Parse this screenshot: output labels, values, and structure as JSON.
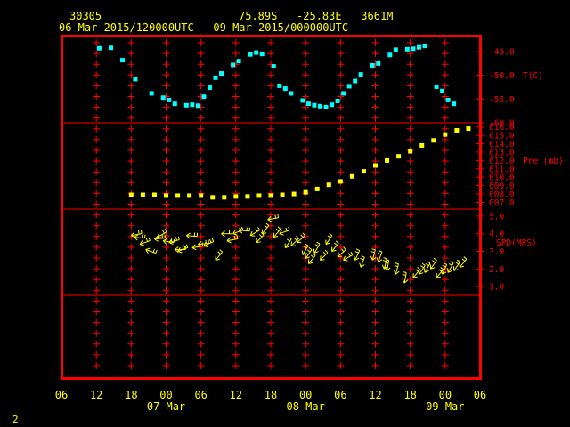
{
  "header": {
    "station": "30305",
    "location": "75.89S   -25.83E   3661M",
    "time_range": "06 Mar 2015/120000UTC - 09 Mar 2015/000000UTC"
  },
  "page_number": "2",
  "colors": {
    "frame": "#ff0000",
    "axis_text": "#ffff00",
    "panel_text": "#ff0000",
    "temperature": "#00ffff",
    "pressure": "#ffff00",
    "wind": "#ffff00"
  },
  "chart_data": {
    "type": "scatter",
    "x_axis": {
      "range_hours": [
        0,
        72
      ],
      "tick_labels": [
        "06",
        "12",
        "18",
        "00",
        "06",
        "12",
        "18",
        "00",
        "06",
        "12",
        "18",
        "00",
        "06"
      ],
      "day_labels": [
        {
          "hour": 18,
          "label": "07 Mar"
        },
        {
          "hour": 42,
          "label": "08 Mar"
        },
        {
          "hour": 66,
          "label": "09 Mar"
        }
      ]
    },
    "panels": [
      {
        "name": "temperature",
        "label": "T(C)",
        "range": [
          -60.0,
          -42.0
        ],
        "tick_labels": [
          "-45.0",
          "-50.0",
          "-55.0",
          "-60.0"
        ],
        "tick_values": [
          -45,
          -50,
          -55,
          -60
        ],
        "x": [
          6.5,
          8.5,
          10.5,
          12.7,
          15.5,
          17.5,
          18.5,
          19.5,
          21.5,
          22.5,
          23.5,
          24.5,
          25.5,
          26.5,
          27.5,
          29.5,
          30.5,
          32.5,
          33.5,
          34.5,
          36.5,
          37.5,
          38.5,
          39.5,
          41.5,
          42.5,
          43.5,
          44.5,
          45.5,
          46.5,
          47.5,
          48.5,
          49.5,
          50.5,
          51.5,
          53.5,
          54.5,
          56.5,
          57.5,
          59.5,
          60.5,
          61.5,
          62.5,
          64.5,
          65.5,
          66.5,
          67.5
        ],
        "y": [
          -44.3,
          -44.2,
          -46.8,
          -50.8,
          -53.8,
          -54.7,
          -55.2,
          -56.0,
          -56.3,
          -56.2,
          -56.4,
          -54.5,
          -52.6,
          -50.5,
          -49.6,
          -47.8,
          -47.0,
          -45.6,
          -45.2,
          -45.5,
          -48.1,
          -52.2,
          -52.8,
          -53.8,
          -55.3,
          -56.0,
          -56.3,
          -56.5,
          -56.7,
          -56.2,
          -55.4,
          -53.8,
          -52.3,
          -51.2,
          -49.8,
          -47.9,
          -47.5,
          -45.7,
          -44.6,
          -44.5,
          -44.4,
          -44.1,
          -43.8,
          -52.4,
          -53.3,
          -55.2,
          -56.0
        ]
      },
      {
        "name": "pressure",
        "label": "Pre (mb)",
        "range": [
          606.2,
          616.5
        ],
        "tick_labels": [
          "616.0",
          "615.0",
          "614.0",
          "613.0",
          "612.0",
          "611.0",
          "610.0",
          "609.0",
          "608.0",
          "607.0"
        ],
        "tick_values": [
          616,
          615,
          614,
          613,
          612,
          611,
          610,
          609,
          608,
          607
        ],
        "x": [
          12.0,
          14.0,
          16.0,
          18.0,
          20.0,
          22.0,
          24.0,
          26.0,
          28.0,
          30.0,
          32.0,
          34.0,
          36.0,
          38.0,
          40.0,
          42.0,
          44.0,
          46.0,
          48.0,
          50.0,
          52.0,
          54.0,
          56.0,
          58.0,
          60.0,
          62.0,
          64.0,
          66.0,
          68.0,
          70.0
        ],
        "y": [
          607.9,
          607.9,
          607.9,
          607.8,
          607.8,
          607.8,
          607.8,
          607.6,
          607.6,
          607.7,
          607.7,
          607.8,
          607.8,
          607.9,
          608.0,
          608.2,
          608.6,
          609.1,
          609.5,
          610.1,
          610.7,
          611.4,
          612.0,
          612.5,
          613.1,
          613.8,
          614.4,
          615.1,
          615.6,
          615.8
        ]
      },
      {
        "name": "wind_speed",
        "label": "SPD(MPS)",
        "range": [
          0.5,
          5.4
        ],
        "tick_labels": [
          "5.0",
          "4.0",
          "3.0",
          "2.0",
          "1.0"
        ],
        "tick_values": [
          5,
          4,
          3,
          2,
          1
        ],
        "x": [
          12.0,
          12.5,
          13.5,
          14.5,
          16.0,
          16.5,
          17.5,
          18.5,
          19.5,
          20.0,
          21.5,
          22.5,
          23.5,
          24.5,
          26.5,
          27.5,
          28.5,
          29.5,
          30.5,
          32.5,
          33.5,
          34.5,
          35.5,
          36.5,
          37.5,
          38.5,
          39.5,
          40.5,
          41.5,
          42.0,
          42.5,
          43.5,
          44.5,
          45.5,
          46.5,
          47.5,
          48.5,
          50.5,
          51.5,
          53.5,
          54.5,
          55.5,
          56.0,
          57.5,
          59.0,
          60.5,
          61.5,
          62.5,
          63.5,
          64.5,
          65.5,
          66.5,
          67.5,
          68.5
        ],
        "y": [
          3.9,
          3.8,
          3.4,
          3.1,
          3.7,
          3.8,
          3.6,
          3.5,
          3.1,
          3.0,
          3.9,
          3.2,
          3.4,
          3.3,
          2.5,
          4.0,
          3.6,
          4.0,
          4.2,
          3.9,
          3.5,
          4.0,
          4.8,
          3.8,
          4.0,
          3.2,
          3.3,
          3.5,
          2.8,
          2.6,
          2.3,
          2.9,
          2.5,
          3.4,
          3.0,
          2.7,
          2.5,
          2.5,
          2.1,
          2.5,
          2.4,
          2.0,
          1.9,
          1.7,
          1.2,
          1.5,
          1.7,
          1.8,
          2.0,
          1.5,
          1.7,
          1.8,
          1.9,
          2.1
        ],
        "dir_deg": [
          80,
          95,
          70,
          110,
          85,
          60,
          100,
          75,
          90,
          70,
          95,
          80,
          85,
          65,
          40,
          90,
          80,
          70,
          95,
          60,
          45,
          40,
          80,
          40,
          70,
          35,
          45,
          50,
          30,
          35,
          40,
          30,
          45,
          35,
          40,
          50,
          60,
          25,
          20,
          15,
          20,
          15,
          10,
          15,
          10,
          40,
          35,
          30,
          35,
          40,
          25,
          30,
          35,
          40
        ]
      }
    ]
  }
}
